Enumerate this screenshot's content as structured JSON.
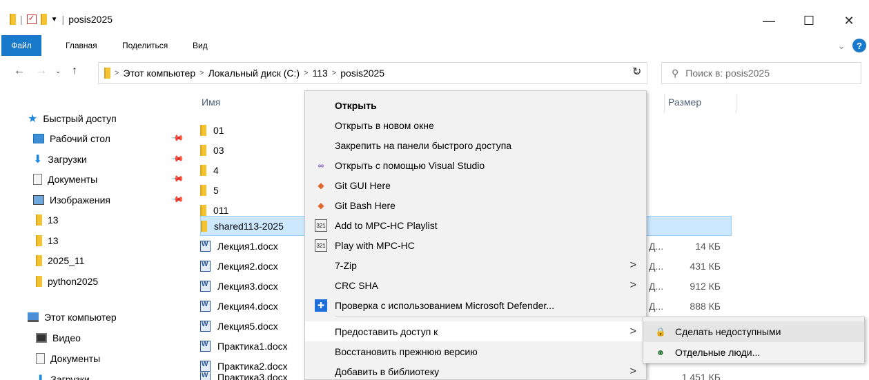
{
  "window": {
    "title": "posis2025",
    "buttons": {
      "minimize": "—",
      "maximize": "☐",
      "close": "✕"
    }
  },
  "ribbon": {
    "tabs": [
      "Файл",
      "Главная",
      "Поделиться",
      "Вид"
    ],
    "help": "?"
  },
  "address": {
    "segments": [
      "Этот компьютер",
      "Локальный диск (C:)",
      "113",
      "posis2025"
    ],
    "search_placeholder": "Поиск в: posis2025"
  },
  "nav": {
    "quick_access": "Быстрый доступ",
    "items": [
      {
        "label": "Рабочий стол",
        "icon": "desktop-icon",
        "pinned": true
      },
      {
        "label": "Загрузки",
        "icon": "downloads-icon",
        "pinned": true
      },
      {
        "label": "Документы",
        "icon": "documents-icon",
        "pinned": true
      },
      {
        "label": "Изображения",
        "icon": "pictures-icon",
        "pinned": true
      },
      {
        "label": "13",
        "icon": "folder-icon"
      },
      {
        "label": "13",
        "icon": "folder-icon"
      },
      {
        "label": "2025_11",
        "icon": "folder-icon"
      },
      {
        "label": "python2025",
        "icon": "folder-icon"
      }
    ],
    "this_pc": "Этот компьютер",
    "pc_items": [
      {
        "label": "Видео",
        "icon": "video-icon"
      },
      {
        "label": "Документы",
        "icon": "documents-icon"
      },
      {
        "label": "Загрузки",
        "icon": "downloads-icon"
      }
    ]
  },
  "files": {
    "columns": {
      "name": "Имя",
      "size": "Размер"
    },
    "rows": [
      {
        "name": "01",
        "type": "folder",
        "size": ""
      },
      {
        "name": "03",
        "type": "folder",
        "size": ""
      },
      {
        "name": "4",
        "type": "folder",
        "size": ""
      },
      {
        "name": "5",
        "type": "folder",
        "size": ""
      },
      {
        "name": "011",
        "type": "folder",
        "size": ""
      },
      {
        "name": "shared113-2025",
        "type": "folder",
        "size": "",
        "selected": true
      },
      {
        "name": "Лекция1.docx",
        "type": "word",
        "size": "14 КБ"
      },
      {
        "name": "Лекция2.docx",
        "type": "word",
        "size": "431 КБ"
      },
      {
        "name": "Лекция3.docx",
        "type": "word",
        "size": "912 КБ"
      },
      {
        "name": "Лекция4.docx",
        "type": "word",
        "size": "888 КБ"
      },
      {
        "name": "Лекция5.docx",
        "type": "word",
        "size": ""
      },
      {
        "name": "Практика1.docx",
        "type": "word",
        "size": ""
      },
      {
        "name": "Практика2.docx",
        "type": "word",
        "size": ""
      },
      {
        "name": "Практика3.docx",
        "type": "word",
        "size": "1 451 КБ"
      }
    ],
    "truncated_type": "Д..."
  },
  "context_menu": [
    {
      "label": "Открыть",
      "bold": true
    },
    {
      "label": "Открыть в новом окне"
    },
    {
      "label": "Закрепить на панели быстрого доступа"
    },
    {
      "label": "Открыть с помощью Visual Studio",
      "icon": "visual-studio-icon"
    },
    {
      "label": "Git GUI Here",
      "icon": "git-icon"
    },
    {
      "label": "Git Bash Here",
      "icon": "git-icon"
    },
    {
      "label": "Add to MPC-HC Playlist",
      "icon": "mpc-hc-icon"
    },
    {
      "label": "Play with MPC-HC",
      "icon": "mpc-hc-icon"
    },
    {
      "label": "7-Zip",
      "submenu": true
    },
    {
      "label": "CRC SHA",
      "submenu": true
    },
    {
      "label": "Проверка с использованием Microsoft Defender...",
      "icon": "defender-icon"
    },
    {
      "label": "Предоставить доступ к",
      "submenu": true,
      "hover": true
    },
    {
      "label": "Восстановить прежнюю версию"
    },
    {
      "label": "Добавить в библиотеку",
      "submenu": true
    }
  ],
  "submenu": [
    {
      "label": "Сделать недоступными",
      "icon": "lock-icon",
      "hover": true
    },
    {
      "label": "Отдельные люди...",
      "icon": "people-icon"
    }
  ]
}
